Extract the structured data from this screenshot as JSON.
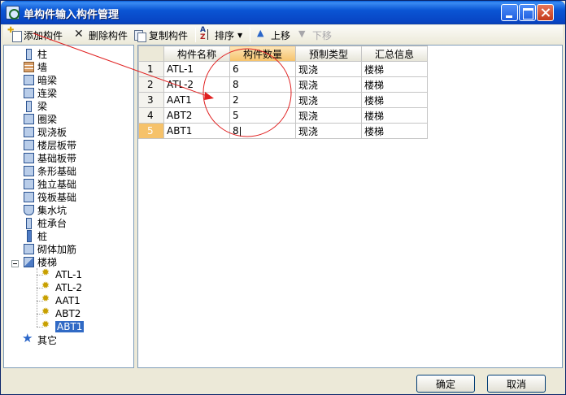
{
  "window": {
    "title": "单构件输入构件管理",
    "title_bar_color": "#0a55d4"
  },
  "toolbar": {
    "add_label": "添加构件",
    "delete_label": "删除构件",
    "copy_label": "复制构件",
    "sort_label": "排序",
    "up_label": "上移",
    "down_label": "下移"
  },
  "tree": {
    "items": [
      {
        "label": "柱",
        "icon": "column-icon"
      },
      {
        "label": "墙",
        "icon": "wall-icon"
      },
      {
        "label": "暗梁",
        "icon": "hidden-beam-icon"
      },
      {
        "label": "连梁",
        "icon": "coupling-beam-icon"
      },
      {
        "label": "梁",
        "icon": "beam-icon"
      },
      {
        "label": "圈梁",
        "icon": "ring-beam-icon"
      },
      {
        "label": "现浇板",
        "icon": "slab-icon"
      },
      {
        "label": "楼层板带",
        "icon": "floor-strip-icon"
      },
      {
        "label": "基础板带",
        "icon": "foundation-strip-icon"
      },
      {
        "label": "条形基础",
        "icon": "strip-foundation-icon"
      },
      {
        "label": "独立基础",
        "icon": "isolated-foundation-icon"
      },
      {
        "label": "筏板基础",
        "icon": "raft-foundation-icon"
      },
      {
        "label": "集水坑",
        "icon": "sump-pit-icon"
      },
      {
        "label": "桩承台",
        "icon": "pile-cap-icon"
      },
      {
        "label": "桩",
        "icon": "pile-icon"
      },
      {
        "label": "砌体加筋",
        "icon": "masonry-rebar-icon"
      },
      {
        "label": "楼梯",
        "icon": "stair-icon"
      },
      {
        "label": "其它",
        "icon": "star-icon"
      }
    ],
    "stair_children": [
      "ATL-1",
      "ATL-2",
      "AAT1",
      "ABT2",
      "ABT1"
    ],
    "selected": "ABT1"
  },
  "grid": {
    "columns": [
      "构件名称",
      "构件数量",
      "预制类型",
      "汇总信息"
    ],
    "active_column": "构件数量",
    "rows": [
      {
        "num": "1",
        "name": "ATL-1",
        "count": "6",
        "type": "现浇",
        "summary": "楼梯"
      },
      {
        "num": "2",
        "name": "ATL-2",
        "count": "8",
        "type": "现浇",
        "summary": "楼梯"
      },
      {
        "num": "3",
        "name": "AAT1",
        "count": "2",
        "type": "现浇",
        "summary": "楼梯"
      },
      {
        "num": "4",
        "name": "ABT2",
        "count": "5",
        "type": "现浇",
        "summary": "楼梯"
      },
      {
        "num": "5",
        "name": "ABT1",
        "count": "8",
        "type": "现浇",
        "summary": "楼梯"
      }
    ],
    "active_row": "5"
  },
  "footer": {
    "ok_label": "确定",
    "cancel_label": "取消"
  },
  "annotation_color": "#e02020"
}
